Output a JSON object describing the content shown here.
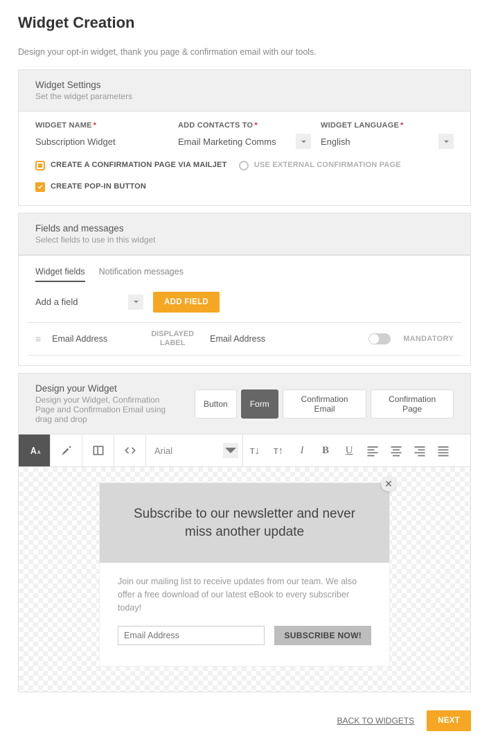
{
  "page": {
    "title": "Widget Creation",
    "subtitle": "Design your opt-in widget, thank you page & confirmation email with our tools."
  },
  "settings": {
    "title": "Widget Settings",
    "sub": "Set the widget parameters",
    "name_label": "WIDGET NAME",
    "name_value": "Subscription Widget",
    "contacts_label": "ADD CONTACTS TO",
    "contacts_value": "Email Marketing Comms",
    "lang_label": "WIDGET LANGUAGE",
    "lang_value": "English",
    "opt_conf_mailjet": "CREATE A CONFIRMATION PAGE VIA MAILJET",
    "opt_conf_ext": "USE EXTERNAL CONFIRMATION PAGE",
    "opt_popin": "CREATE POP-IN BUTTON"
  },
  "fields": {
    "title": "Fields and messages",
    "sub": "Select fields to use in this widget",
    "tabs": [
      "Widget fields",
      "Notification messages"
    ],
    "active_tab": 0,
    "add_label": "Add a field",
    "add_btn": "ADD FIELD",
    "row": {
      "field": "Email Address",
      "display_label": "DISPLAYED LABEL",
      "display_value": "Email Address",
      "mandatory": "MANDATORY"
    }
  },
  "design": {
    "title": "Design your Widget",
    "sub": "Design your Widget, Confirmation Page and Confirmation Email using drag and drop",
    "seg": [
      "Button",
      "Form",
      "Confirmation Email",
      "Confirmation Page"
    ],
    "active_seg": 1,
    "toolbar": {
      "font": "Arial"
    },
    "form": {
      "hero": "Subscribe to our newsletter and never miss another update",
      "para": "Join our mailing list to receive updates from our team. We also offer a free download of our latest eBook to every subscriber today!",
      "placeholder": "Email Address",
      "submit": "SUBSCRIBE NOW!"
    }
  },
  "footer": {
    "back": "BACK TO WIDGETS",
    "next": "NEXT"
  },
  "req": "*"
}
